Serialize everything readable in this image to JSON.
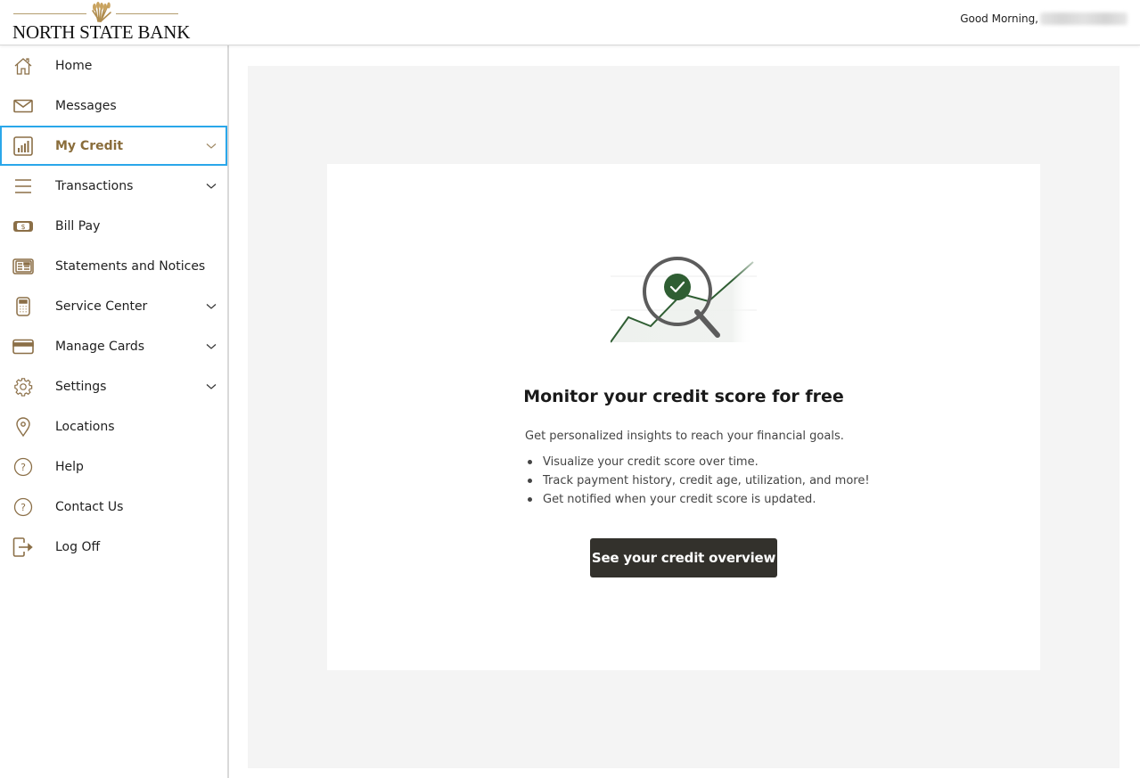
{
  "header": {
    "brand": "NORTH STATE BANK",
    "greeting": "Good Morning,",
    "user_name_redacted": true
  },
  "sidebar": {
    "items": [
      {
        "label": "Home",
        "icon": "home-icon",
        "expandable": false,
        "active": false
      },
      {
        "label": "Messages",
        "icon": "envelope-icon",
        "expandable": false,
        "active": false
      },
      {
        "label": "My Credit",
        "icon": "bar-chart-icon",
        "expandable": true,
        "active": true
      },
      {
        "label": "Transactions",
        "icon": "list-icon",
        "expandable": true,
        "active": false
      },
      {
        "label": "Bill Pay",
        "icon": "dollar-bill-icon",
        "expandable": false,
        "active": false
      },
      {
        "label": "Statements and Notices",
        "icon": "newspaper-icon",
        "expandable": false,
        "active": false
      },
      {
        "label": "Service Center",
        "icon": "calculator-icon",
        "expandable": true,
        "active": false
      },
      {
        "label": "Manage Cards",
        "icon": "credit-card-icon",
        "expandable": true,
        "active": false
      },
      {
        "label": "Settings",
        "icon": "gear-icon",
        "expandable": true,
        "active": false
      },
      {
        "label": "Locations",
        "icon": "map-pin-icon",
        "expandable": false,
        "active": false
      },
      {
        "label": "Help",
        "icon": "question-circle-icon",
        "expandable": false,
        "active": false
      },
      {
        "label": "Contact Us",
        "icon": "question-circle-icon",
        "expandable": false,
        "active": false
      },
      {
        "label": "Log Off",
        "icon": "logout-icon",
        "expandable": false,
        "active": false
      }
    ]
  },
  "main": {
    "card": {
      "title": "Monitor your credit score for free",
      "intro": "Get personalized insights to reach your financial goals.",
      "bullets": [
        "Visualize your credit score over time.",
        "Track payment history, credit age, utilization, and more!",
        "Get notified when your credit score is updated."
      ],
      "cta_label": "See your credit overview"
    }
  },
  "colors": {
    "brand_gold": "#8a6d3b",
    "icon_gold": "#8b6f47",
    "active_outline": "#2aa7ea",
    "cta_bg": "#33312c",
    "illustration_green": "#2f5e33",
    "panel_bg": "#f4f4f4"
  }
}
